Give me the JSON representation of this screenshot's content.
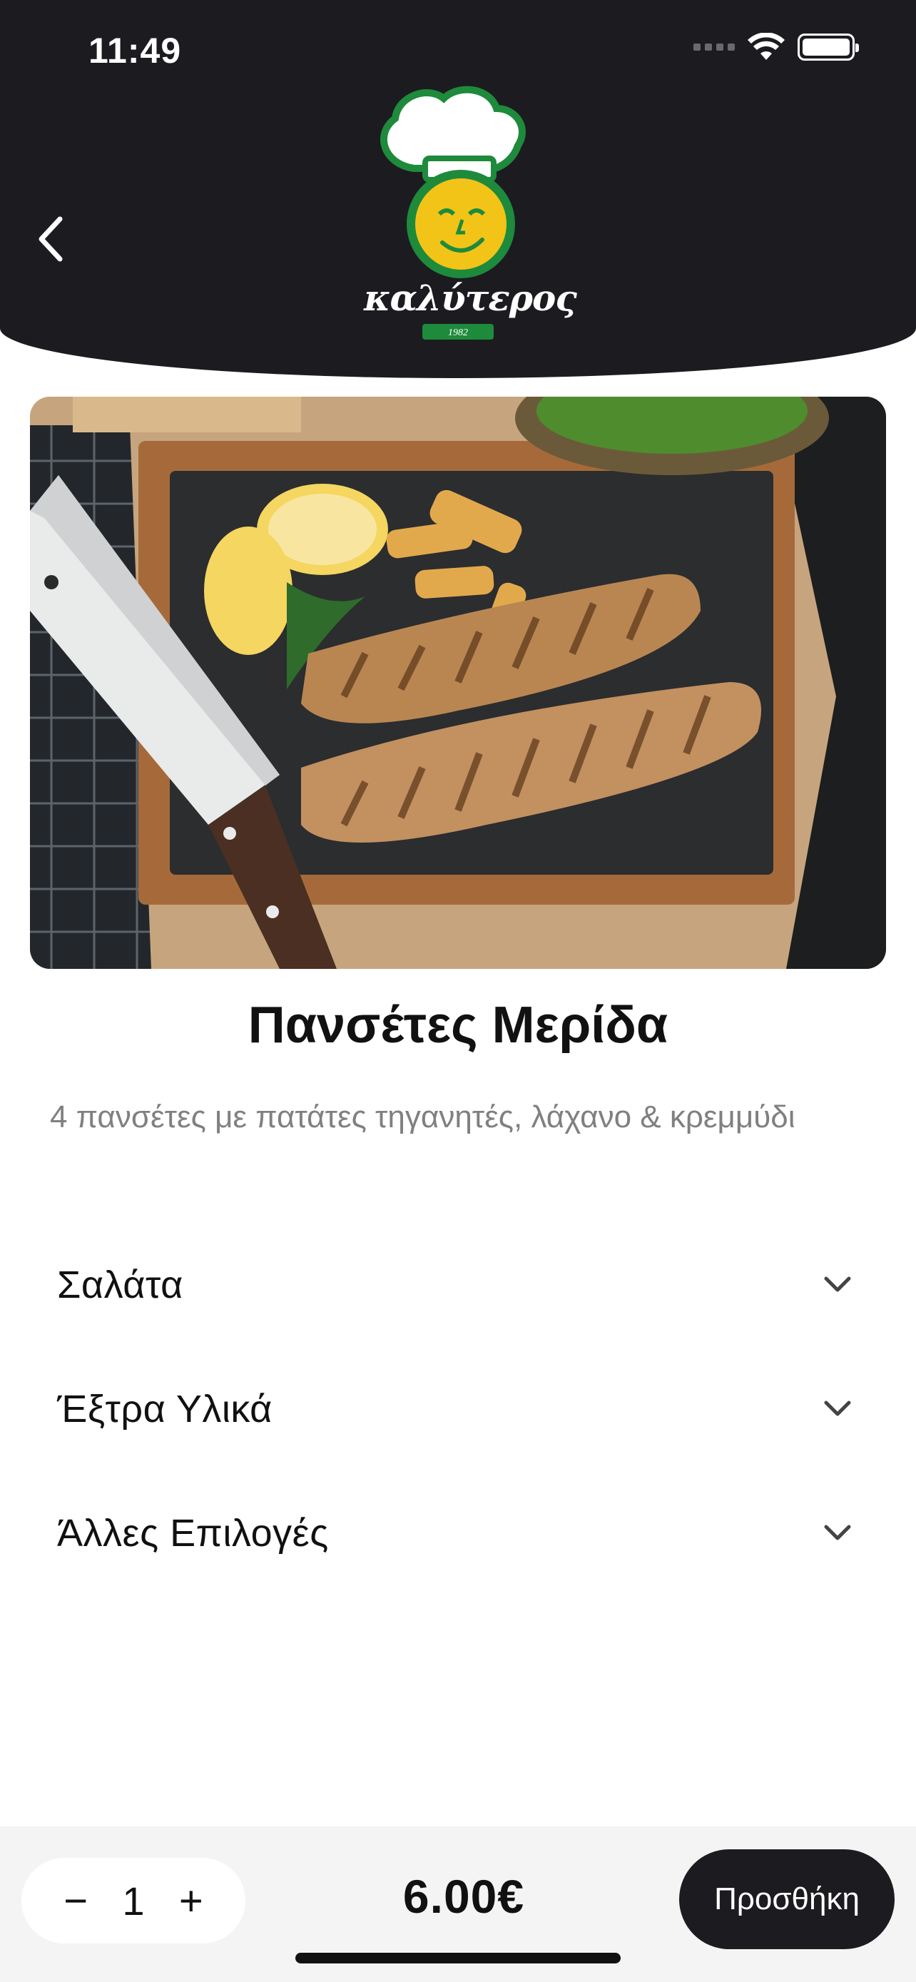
{
  "status_bar": {
    "time": "11:49",
    "icons": [
      "signal-icon",
      "wifi-icon",
      "battery-icon"
    ]
  },
  "header": {
    "back_icon": "chevron-left-icon",
    "logo": {
      "brand_text": "καλύτερος",
      "year": "1982"
    },
    "background": "#1c1b20"
  },
  "product": {
    "image": "grilled-pork-chops-on-slate-board",
    "title": "Πανσέτες Μερίδα",
    "description": "4 πανσέτες με πατάτες τηγανητές, λάχανο & κρεμμύδι"
  },
  "options": [
    {
      "label": "Σαλάτα",
      "icon": "chevron-down-icon"
    },
    {
      "label": "Έξτρα Υλικά",
      "icon": "chevron-down-icon"
    },
    {
      "label": "Άλλες Επιλογές",
      "icon": "chevron-down-icon"
    }
  ],
  "bottom_bar": {
    "decrement_label": "−",
    "quantity": "1",
    "increment_label": "+",
    "price": "6.00€",
    "add_label": "Προσθήκη"
  },
  "colors": {
    "header_bg": "#1c1b20",
    "accent_green": "#1e8a3c",
    "logo_yellow": "#f2c417",
    "add_button_bg": "#1c1b1f",
    "bottom_bar_bg": "#f4f4f4"
  }
}
